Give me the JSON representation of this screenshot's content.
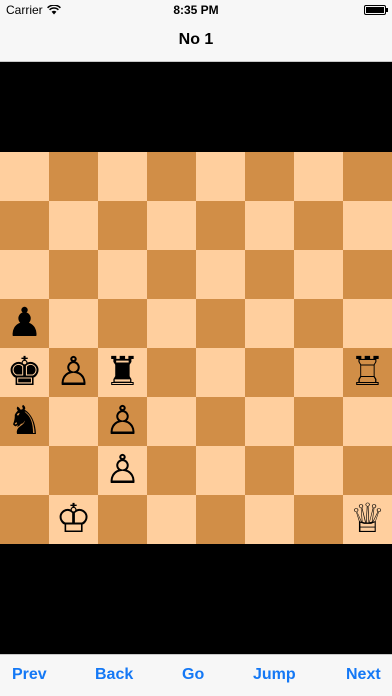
{
  "status_bar": {
    "carrier": "Carrier",
    "wifi_icon": "wifi-icon",
    "time": "8:35 PM",
    "battery_icon": "battery-icon",
    "battery_level": 1.0
  },
  "nav": {
    "title": "No 1"
  },
  "board": {
    "light_color": "#ffcf9e",
    "dark_color": "#d18e47",
    "pieces": [
      {
        "square": "a5",
        "glyph": "♟",
        "name": "black-pawn"
      },
      {
        "square": "a4",
        "glyph": "♚",
        "name": "black-king"
      },
      {
        "square": "b4",
        "glyph": "♙",
        "name": "white-pawn"
      },
      {
        "square": "c4",
        "glyph": "♜",
        "name": "black-rook"
      },
      {
        "square": "h4",
        "glyph": "♖",
        "name": "white-rook"
      },
      {
        "square": "a3",
        "glyph": "♞",
        "name": "black-knight"
      },
      {
        "square": "c3",
        "glyph": "♙",
        "name": "white-pawn"
      },
      {
        "square": "c2",
        "glyph": "♙",
        "name": "white-pawn"
      },
      {
        "square": "b1",
        "glyph": "♔",
        "name": "white-king"
      },
      {
        "square": "h1",
        "glyph": "♕",
        "name": "white-queen"
      }
    ]
  },
  "toolbar": {
    "prev_label": "Prev",
    "back_label": "Back",
    "go_label": "Go",
    "jump_label": "Jump",
    "next_label": "Next",
    "accent": "#1478f5"
  }
}
